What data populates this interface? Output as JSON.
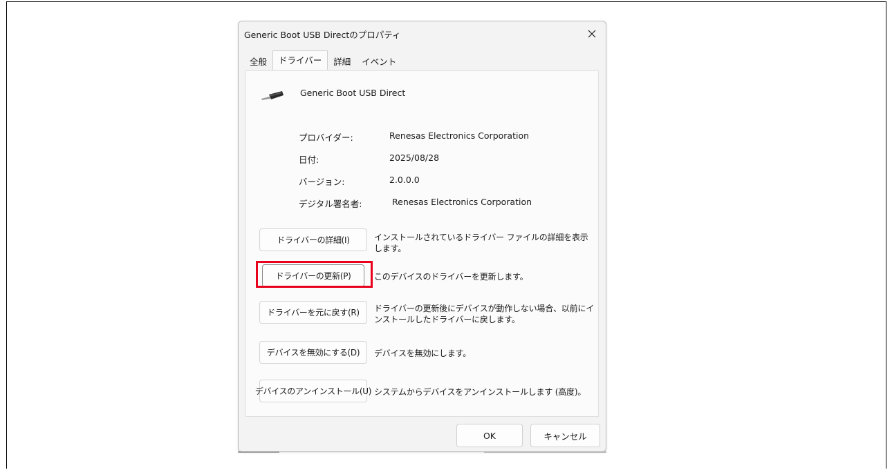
{
  "dialog": {
    "title": "Generic Boot USB Directのプロパティ",
    "close_icon": "close-icon",
    "tabs": [
      {
        "label": "全般",
        "active": false
      },
      {
        "label": "ドライバー",
        "active": true
      },
      {
        "label": "詳細",
        "active": false
      },
      {
        "label": "イベント",
        "active": false
      }
    ]
  },
  "device": {
    "icon": "usb-plug-icon",
    "name": "Generic Boot USB Direct"
  },
  "properties": [
    {
      "label": "プロバイダー:",
      "value": "Renesas Electronics Corporation"
    },
    {
      "label": "日付:",
      "value": "2025/08/28"
    },
    {
      "label": "バージョン:",
      "value": "2.0.0.0"
    },
    {
      "label": "デジタル署名者:",
      "value": "Renesas Electronics Corporation"
    }
  ],
  "actions": [
    {
      "button": "ドライバーの詳細(I)",
      "description": "インストールされているドライバー ファイルの詳細を表示します。"
    },
    {
      "button": "ドライバーの更新(P)",
      "description": "このデバイスのドライバーを更新します。",
      "highlighted": true
    },
    {
      "button": "ドライバーを元に戻す(R)",
      "description": "ドライバーの更新後にデバイスが動作しない場合、以前にインストールしたドライバーに戻します。"
    },
    {
      "button": "デバイスを無効にする(D)",
      "description": "デバイスを無効にします。"
    },
    {
      "button": "デバイスのアンインストール(U)",
      "description": "システムからデバイスをアンインストールします (高度)。"
    }
  ],
  "footer": {
    "ok_label": "OK",
    "cancel_label": "キャンセル"
  },
  "colors": {
    "highlight": "#e8001c",
    "dialog_bg": "#f3f3f3",
    "panel_bg": "#fbfbfb"
  }
}
